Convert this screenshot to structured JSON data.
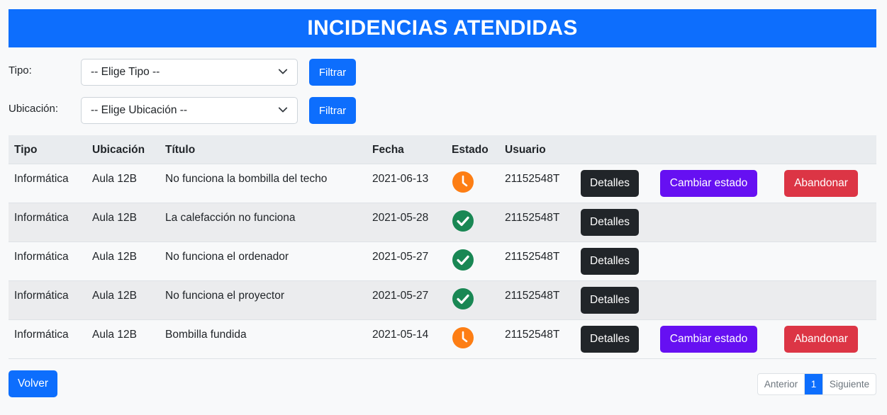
{
  "header": {
    "title": "INCIDENCIAS ATENDIDAS"
  },
  "filters": [
    {
      "label": "Tipo:",
      "select_value": "-- Elige Tipo --",
      "button": "Filtrar"
    },
    {
      "label": "Ubicación:",
      "select_value": "-- Elige Ubicación --",
      "button": "Filtrar"
    }
  ],
  "table": {
    "columns": [
      "Tipo",
      "Ubicación",
      "Título",
      "Fecha",
      "Estado",
      "Usuario"
    ],
    "rows": [
      {
        "tipo": "Informática",
        "ubicacion": "Aula 12B",
        "titulo": "No funciona la bombilla del techo",
        "fecha": "2021-06-13",
        "estado": "clock-icon",
        "usuario": "21152548T",
        "detalles": "Detalles",
        "cambiar": "Cambiar estado",
        "abandonar": "Abandonar"
      },
      {
        "tipo": "Informática",
        "ubicacion": "Aula 12B",
        "titulo": "La calefacción no funciona",
        "fecha": "2021-05-28",
        "estado": "check-icon",
        "usuario": "21152548T",
        "detalles": "Detalles"
      },
      {
        "tipo": "Informática",
        "ubicacion": "Aula 12B",
        "titulo": "No funciona el ordenador",
        "fecha": "2021-05-27",
        "estado": "check-icon",
        "usuario": "21152548T",
        "detalles": "Detalles"
      },
      {
        "tipo": "Informática",
        "ubicacion": "Aula 12B",
        "titulo": "No funciona el proyector",
        "fecha": "2021-05-27",
        "estado": "check-icon",
        "usuario": "21152548T",
        "detalles": "Detalles"
      },
      {
        "tipo": "Informática",
        "ubicacion": "Aula 12B",
        "titulo": "Bombilla fundida",
        "fecha": "2021-05-14",
        "estado": "clock-icon",
        "usuario": "21152548T",
        "detalles": "Detalles",
        "cambiar": "Cambiar estado",
        "abandonar": "Abandonar"
      }
    ]
  },
  "footer": {
    "back_button": "Volver",
    "pagination": {
      "prev": "Anterior",
      "current": "1",
      "next": "Siguiente"
    }
  },
  "colors": {
    "primary": "#0d6efd",
    "dark": "#212529",
    "purple": "#6610f2",
    "danger": "#dc3545",
    "pending": "#fd7e14",
    "done": "#198754"
  }
}
